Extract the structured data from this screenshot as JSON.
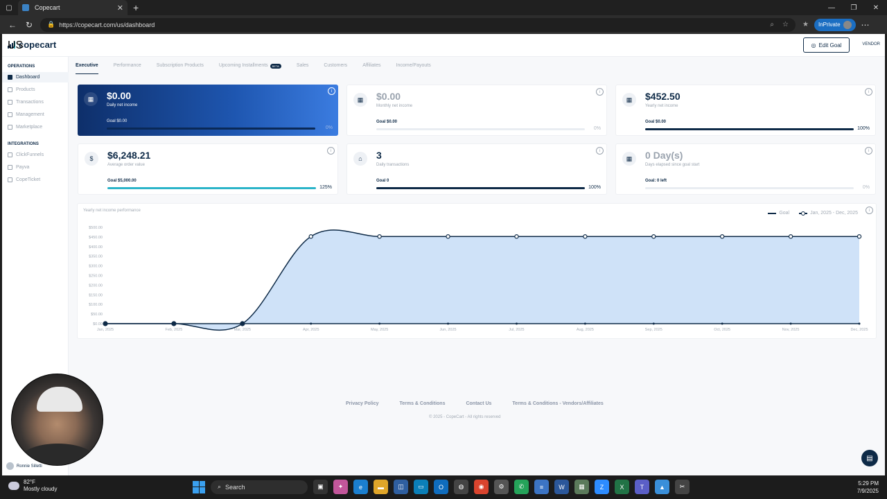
{
  "browser": {
    "tab_title": "Copecart",
    "url": "https://copecart.com/us/dashboard",
    "inprivate_label": "InPrivate"
  },
  "header": {
    "brand": "copecart",
    "region": "US",
    "edit_goal": "Edit Goal",
    "role": "VENDOR"
  },
  "sidebar": {
    "operations_title": "OPERATIONS",
    "operations": [
      {
        "label": "Dashboard",
        "icon": "grid-icon",
        "active": true
      },
      {
        "label": "Products",
        "icon": "box-icon"
      },
      {
        "label": "Transactions",
        "icon": "arrows-icon"
      },
      {
        "label": "Management",
        "icon": "gear-icon"
      },
      {
        "label": "Marketplace",
        "icon": "store-icon"
      }
    ],
    "integrations_title": "INTEGRATIONS",
    "integrations": [
      {
        "label": "ClickFunnels"
      },
      {
        "label": "Payva"
      },
      {
        "label": "CopeTicket"
      }
    ],
    "user_name": "Ronnie Silletti"
  },
  "tabs": [
    {
      "label": "Executive",
      "active": true
    },
    {
      "label": "Performance"
    },
    {
      "label": "Subscription Products"
    },
    {
      "label": "Upcoming Installments",
      "badge": "BETA"
    },
    {
      "label": "Sales"
    },
    {
      "label": "Customers"
    },
    {
      "label": "Affiliates"
    },
    {
      "label": "Income/Payouts"
    }
  ],
  "cards": [
    {
      "value": "$0.00",
      "label": "Daily net income",
      "goal": "Goal $0.00",
      "pct": "0%",
      "progress": 0.0
    },
    {
      "value": "$0.00",
      "label": "Monthly net income",
      "goal": "Goal $0.00",
      "pct": "0%",
      "progress": 0.0
    },
    {
      "value": "$452.50",
      "label": "Yearly net income",
      "goal": "Goal $0.00",
      "pct": "100%",
      "progress": 1.0
    },
    {
      "value": "$6,248.21",
      "label": "Average order value",
      "goal": "Goal $5,000.00",
      "pct": "125%",
      "progress": 1.0
    },
    {
      "value": "3",
      "label": "Daily transactions",
      "goal": "Goal 0",
      "pct": "100%",
      "progress": 1.0
    },
    {
      "value": "0 Day(s)",
      "label": "Days elapsed since goal start",
      "goal": "Goal: 0 left",
      "pct": "0%",
      "progress": 0.0
    }
  ],
  "chart_data": {
    "type": "area",
    "title": "Yearly net income performance",
    "x": [
      "Jan, 2025",
      "Feb, 2025",
      "Mar, 2025",
      "Apr, 2025",
      "May, 2025",
      "Jun, 2025",
      "Jul, 2025",
      "Aug, 2025",
      "Sep, 2025",
      "Oct, 2025",
      "Nov, 2025",
      "Dec, 2025"
    ],
    "series": [
      {
        "name": "Goal",
        "values": [
          0,
          0,
          0,
          0,
          0,
          0,
          0,
          0,
          0,
          0,
          0,
          0
        ]
      },
      {
        "name": "Jan, 2025 - Dec, 2025",
        "values": [
          0,
          0,
          0,
          452.5,
          452.5,
          452.5,
          452.5,
          452.5,
          452.5,
          452.5,
          452.5,
          452.5
        ]
      }
    ],
    "y_ticks": [
      "$0.00",
      "$50.00",
      "$100.00",
      "$150.00",
      "$200.00",
      "$250.00",
      "$300.00",
      "$350.00",
      "$400.00",
      "$450.00",
      "$500.00"
    ],
    "ylim": [
      0,
      500
    ],
    "legend": "top-right",
    "colors": {
      "line": "#0e2a47",
      "fill": "#cfe2f8"
    }
  },
  "footer": {
    "links": [
      "Privacy Policy",
      "Terms & Conditions",
      "Contact Us",
      "Terms & Conditions - Vendors/Affiliates"
    ],
    "copyright": "© 2025 - CopeCart - All rights reserved"
  },
  "taskbar": {
    "weather_temp": "82°F",
    "weather_desc": "Mostly cloudy",
    "search_placeholder": "Search",
    "time": "5:29 PM",
    "date": "7/9/2025"
  }
}
